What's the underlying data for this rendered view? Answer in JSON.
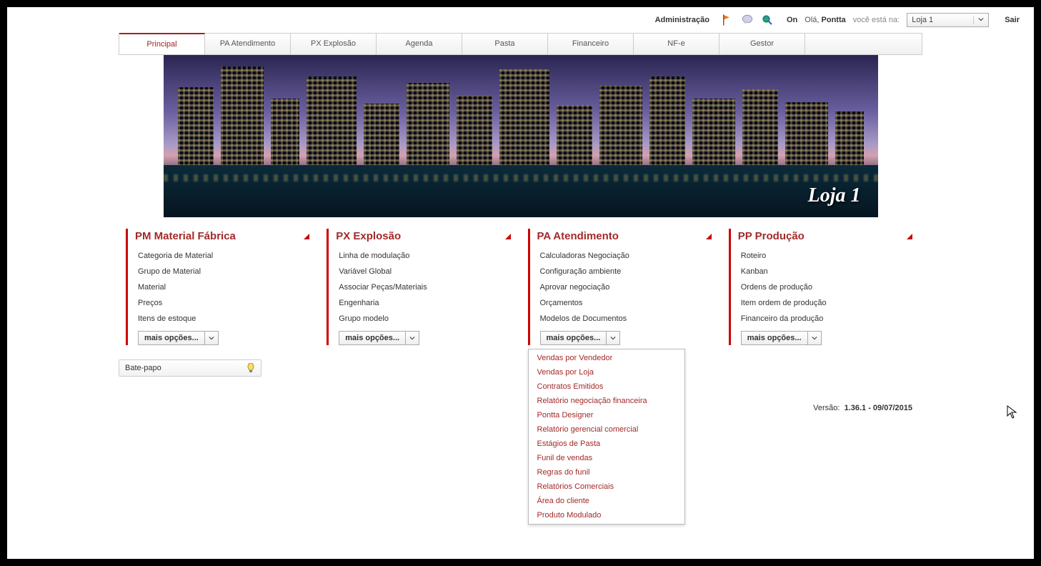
{
  "topbar": {
    "admin": "Administração",
    "on": "On",
    "greeting": "Olá,",
    "username": "Pontta",
    "you_are_at": "você está na:",
    "store_selected": "Loja 1",
    "exit": "Sair"
  },
  "tabs": [
    {
      "label": "Principal",
      "active": true,
      "width": 120
    },
    {
      "label": "PA Atendimento",
      "active": false,
      "width": 120
    },
    {
      "label": "PX Explosão",
      "active": false,
      "width": 120
    },
    {
      "label": "Agenda",
      "active": false,
      "width": 120
    },
    {
      "label": "Pasta",
      "active": false,
      "width": 120
    },
    {
      "label": "Financeiro",
      "active": false,
      "width": 120
    },
    {
      "label": "NF-e",
      "active": false,
      "width": 120
    },
    {
      "label": "Gestor",
      "active": false,
      "width": 120
    }
  ],
  "banner": {
    "label": "Loja 1"
  },
  "cards": [
    {
      "title": "PM Material Fábrica",
      "links": [
        "Categoria de Material",
        "Grupo de Material",
        "Material",
        "Preços",
        "Itens de estoque"
      ],
      "more_label": "mais opções..."
    },
    {
      "title": "PX Explosão",
      "links": [
        "Linha de modulação",
        "Variável Global",
        "Associar Peças/Materiais",
        "Engenharia",
        "Grupo modelo"
      ],
      "more_label": "mais opções..."
    },
    {
      "title": "PA Atendimento",
      "links": [
        "Calculadoras Negociação",
        "Configuração ambiente",
        "Aprovar negociação",
        "Orçamentos",
        "Modelos de Documentos"
      ],
      "more_label": "mais opções...",
      "dropdown": [
        "Vendas por Vendedor",
        "Vendas por Loja",
        "Contratos Emitidos",
        "Relatório negociação financeira",
        "Pontta Designer",
        "Relatório gerencial comercial",
        "Estágios de Pasta",
        "Funil de vendas",
        "Regras do funil",
        "Relatórios Comerciais",
        "Área do cliente",
        "Produto Modulado"
      ]
    },
    {
      "title": "PP Produção",
      "links": [
        "Roteiro",
        "Kanban",
        "Ordens de produção",
        "Item ordem de produção",
        "Financeiro da produção"
      ],
      "more_label": "mais opções..."
    }
  ],
  "chat": {
    "label": "Bate-papo"
  },
  "version": {
    "label": "Versão:",
    "value": "1.36.1 - 09/07/2015"
  }
}
